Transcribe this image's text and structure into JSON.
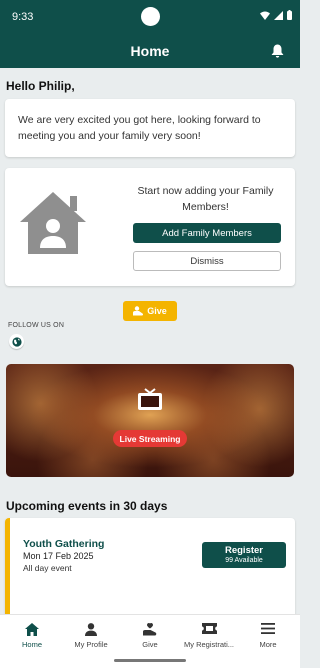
{
  "status_bar": {
    "time": "9:33"
  },
  "app_bar": {
    "title": "Home",
    "notification_icon": "bell-icon"
  },
  "greeting": "Hello Philip,",
  "welcome_card": {
    "message": "We are very excited you got here, looking forward to meeting you and your family very soon!"
  },
  "family_card": {
    "icon": "house-person-icon",
    "prompt": "Start now adding your Family Members!",
    "add_button": "Add Family Members",
    "dismiss_button": "Dismiss"
  },
  "give_button": "Give",
  "follow": {
    "label": "FOLLOW US ON",
    "icon": "globe-icon"
  },
  "live_stream": {
    "label": "Live Streaming",
    "icon": "tv-icon"
  },
  "events": {
    "title": "Upcoming events in 30 days",
    "items": [
      {
        "name": "Youth Gathering",
        "date": "Mon 17 Feb  2025",
        "time": "All day event",
        "button": "Register",
        "availability": "99 Available"
      }
    ]
  },
  "nav": {
    "items": [
      {
        "label": "Home",
        "icon": "home-icon"
      },
      {
        "label": "My Profile",
        "icon": "person-icon"
      },
      {
        "label": "Give",
        "icon": "give-hand-icon"
      },
      {
        "label": "My Registrati...",
        "icon": "ticket-icon"
      },
      {
        "label": "More",
        "icon": "menu-icon"
      }
    ]
  },
  "colors": {
    "primary": "#0f4f4a",
    "accent": "#f4b400",
    "live": "#e53935",
    "background": "#e9edee"
  }
}
